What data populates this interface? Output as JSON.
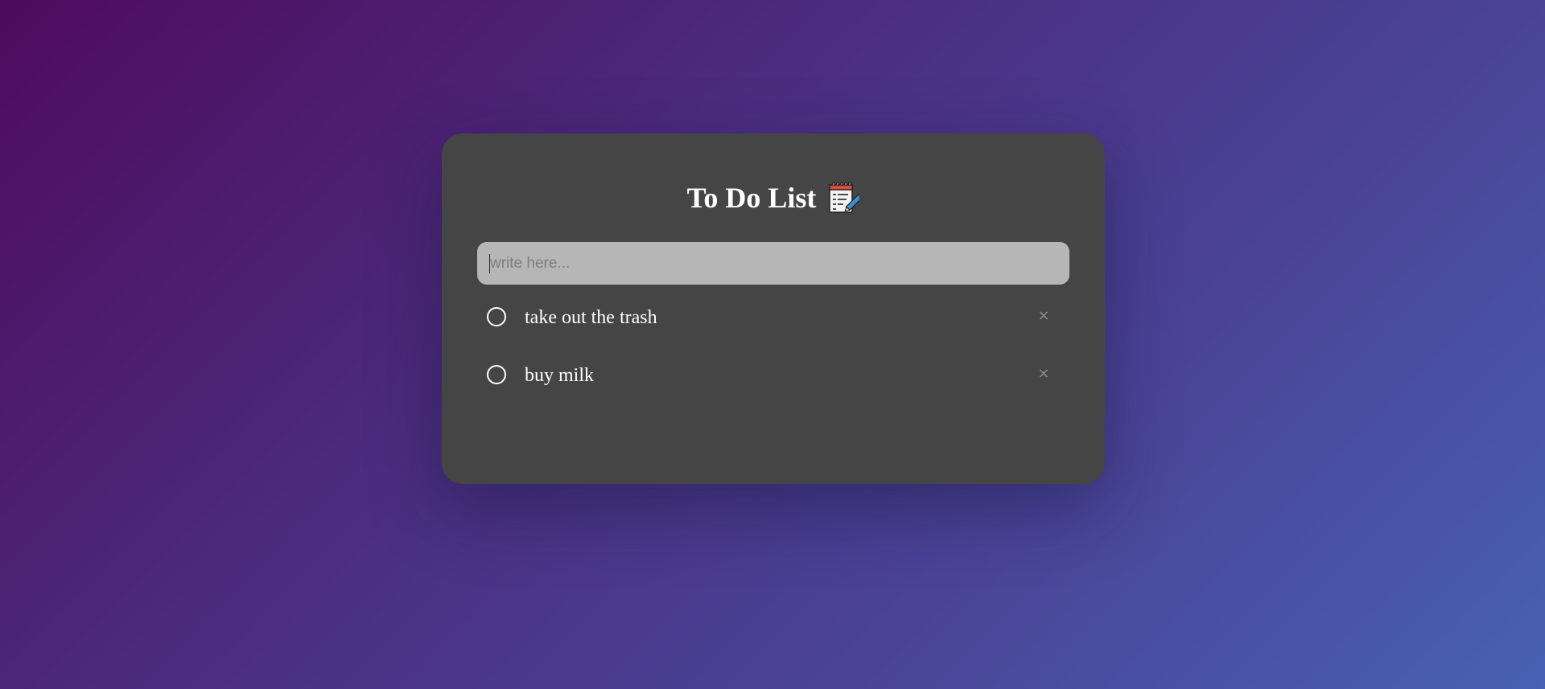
{
  "app": {
    "title": "To Do List",
    "title_icon": "notepad-pencil-icon"
  },
  "input": {
    "placeholder": "write here...",
    "value": ""
  },
  "todos": [
    {
      "text": "take out the trash",
      "completed": false,
      "delete_label": "×"
    },
    {
      "text": "buy milk",
      "completed": false,
      "delete_label": "×"
    }
  ],
  "colors": {
    "card_background": "#454545",
    "input_background": "#b6b6b6",
    "gradient_start": "#4f0b5e",
    "gradient_end": "#4861b2",
    "text": "#ffffff",
    "delete_icon": "#8e8e8e"
  }
}
